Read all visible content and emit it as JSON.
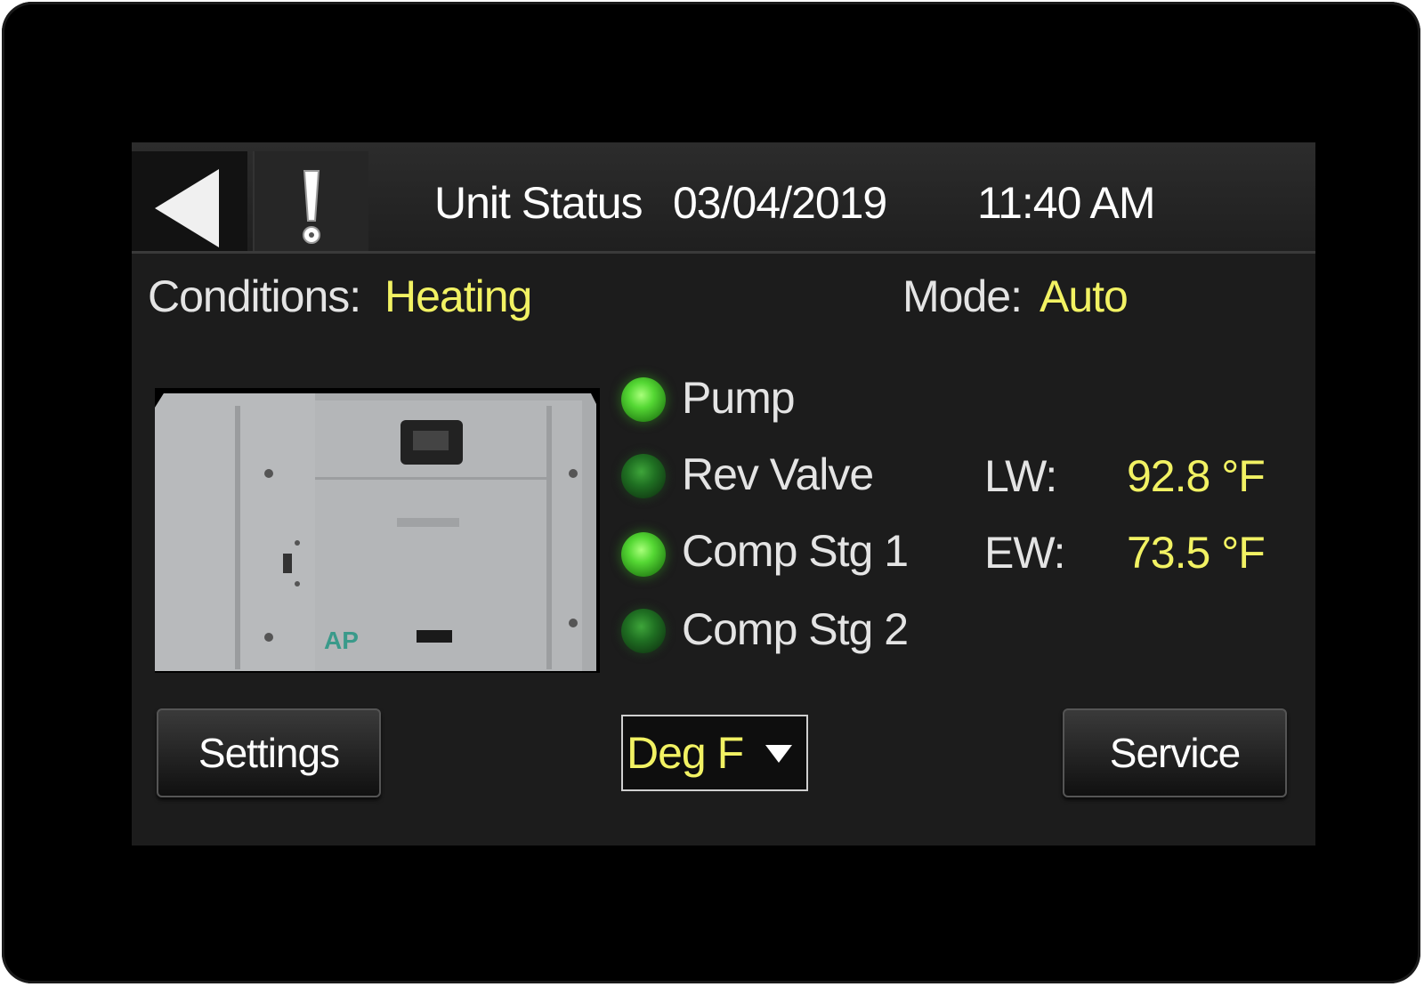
{
  "header": {
    "title": "Unit Status",
    "date": "03/04/2019",
    "time": "11:40 AM",
    "back_icon": "back-arrow-icon",
    "alert_icon": "alert-icon"
  },
  "status": {
    "conditions_label": "Conditions:",
    "conditions_value": "Heating",
    "mode_label": "Mode:",
    "mode_value": "Auto"
  },
  "indicators": [
    {
      "label": "Pump",
      "state": "on"
    },
    {
      "label": "Rev Valve",
      "state": "off"
    },
    {
      "label": "Comp Stg 1",
      "state": "on"
    },
    {
      "label": "Comp Stg 2",
      "state": "off"
    }
  ],
  "temperatures": {
    "lw_label": "LW:",
    "lw_value": "92.8 °F",
    "ew_label": "EW:",
    "ew_value": "73.5 °F"
  },
  "unit_image": {
    "logo_text": "AP"
  },
  "footer": {
    "settings_label": "Settings",
    "units_selected": "Deg F",
    "service_label": "Service"
  },
  "colors": {
    "value_yellow": "#f2f263",
    "led_on": "#55d834",
    "led_off": "#1f6f22",
    "screen_bg": "#1c1c1c"
  }
}
